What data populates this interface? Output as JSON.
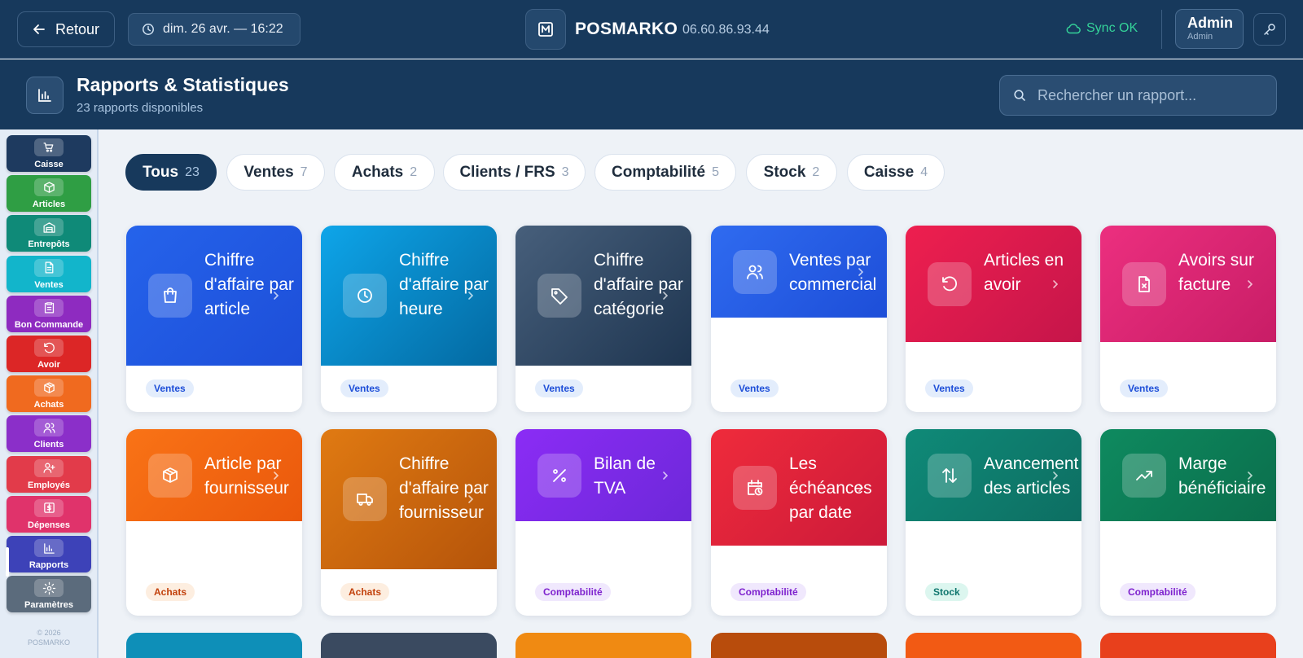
{
  "header": {
    "back_label": "Retour",
    "datetime": "dim. 26 avr. — 16:22",
    "brand_name": "POSMARKO",
    "brand_phone": "06.60.86.93.44",
    "sync_status": "Sync OK",
    "user_name": "Admin",
    "user_role": "Admin"
  },
  "subheader": {
    "title": "Rapports & Statistiques",
    "subtitle": "23 rapports disponibles",
    "search_placeholder": "Rechercher un rapport..."
  },
  "sidebar": {
    "items": [
      {
        "label": "Caisse",
        "icon": "cart-icon",
        "color": "#1e3a5f"
      },
      {
        "label": "Articles",
        "icon": "box-icon",
        "color": "#2f9e44"
      },
      {
        "label": "Entrepôts",
        "icon": "warehouse-icon",
        "color": "#0f8a78"
      },
      {
        "label": "Ventes",
        "icon": "document-icon",
        "color": "#12b5cb"
      },
      {
        "label": "Bon Commande",
        "icon": "clipboard-icon",
        "color": "#8e2bc0"
      },
      {
        "label": "Avoir",
        "icon": "undo-icon",
        "color": "#dc2626"
      },
      {
        "label": "Achats",
        "icon": "package-icon",
        "color": "#f06a1f"
      },
      {
        "label": "Clients",
        "icon": "users-icon",
        "color": "#8b2fc9"
      },
      {
        "label": "Employés",
        "icon": "user-plus-icon",
        "color": "#e23b4a"
      },
      {
        "label": "Dépenses",
        "icon": "dollar-icon",
        "color": "#e0336b"
      },
      {
        "label": "Rapports",
        "icon": "chart-icon",
        "color": "#3d42b8"
      },
      {
        "label": "Paramètres",
        "icon": "gear-icon",
        "color": "#5b6b7c"
      }
    ],
    "copyright_line1": "© 2026",
    "copyright_line2": "POSMARKO"
  },
  "tabs": [
    {
      "label": "Tous",
      "count": "23",
      "active": true
    },
    {
      "label": "Ventes",
      "count": "7"
    },
    {
      "label": "Achats",
      "count": "2"
    },
    {
      "label": "Clients / FRS",
      "count": "3"
    },
    {
      "label": "Comptabilité",
      "count": "5"
    },
    {
      "label": "Stock",
      "count": "2"
    },
    {
      "label": "Caisse",
      "count": "4"
    }
  ],
  "cards": [
    {
      "title": "Chiffre d'affaire par article",
      "category": "Ventes",
      "icon": "bag-icon",
      "gradient": [
        "#2563eb",
        "#1d4ed8"
      ]
    },
    {
      "title": "Chiffre d'affaire par heure",
      "category": "Ventes",
      "icon": "clock-icon",
      "gradient": [
        "#0ea5e9",
        "#0369a1"
      ]
    },
    {
      "title": "Chiffre d'affaire par catégorie",
      "category": "Ventes",
      "icon": "tag-icon",
      "gradient": [
        "#475f7b",
        "#1e3550"
      ]
    },
    {
      "title": "Ventes par commercial",
      "category": "Ventes",
      "icon": "users-icon",
      "gradient": [
        "#2f6bf0",
        "#1d4ed8"
      ]
    },
    {
      "title": "Articles en avoir",
      "category": "Ventes",
      "icon": "undo-icon",
      "gradient": [
        "#ee1f4f",
        "#c5154a"
      ]
    },
    {
      "title": "Avoirs sur facture",
      "category": "Ventes",
      "icon": "file-x-icon",
      "gradient": [
        "#ec2f7f",
        "#c81d66"
      ]
    },
    {
      "title": "Article par fournisseur",
      "category": "Achats",
      "icon": "package-icon",
      "gradient": [
        "#f97316",
        "#ea580c"
      ]
    },
    {
      "title": "Chiffre d'affaire par fournisseur",
      "category": "Achats",
      "icon": "truck-icon",
      "gradient": [
        "#e07a12",
        "#b5540a"
      ]
    },
    {
      "title": "Bilan de TVA",
      "category": "Comptabilité",
      "icon": "percent-icon",
      "gradient": [
        "#8b2cf5",
        "#6d28d9"
      ]
    },
    {
      "title": "Les échéances par date",
      "category": "Comptabilité",
      "icon": "calendar-clock-icon",
      "gradient": [
        "#ef2b3b",
        "#cc1a3a"
      ]
    },
    {
      "title": "Avancement des articles",
      "category": "Stock",
      "icon": "arrows-updown-icon",
      "gradient": [
        "#0f8a78",
        "#0d6e62"
      ]
    },
    {
      "title": "Marge bénéficiaire",
      "category": "Comptabilité",
      "icon": "trending-up-icon",
      "gradient": [
        "#0e8a5f",
        "#0b6e4c"
      ]
    }
  ],
  "partial_cards": [
    {
      "color": "#0e8fb8"
    },
    {
      "color": "#3a4a60"
    },
    {
      "color": "#f08a12"
    },
    {
      "color": "#b84c0c"
    },
    {
      "color": "#f25a14"
    },
    {
      "color": "#e8401c"
    }
  ]
}
